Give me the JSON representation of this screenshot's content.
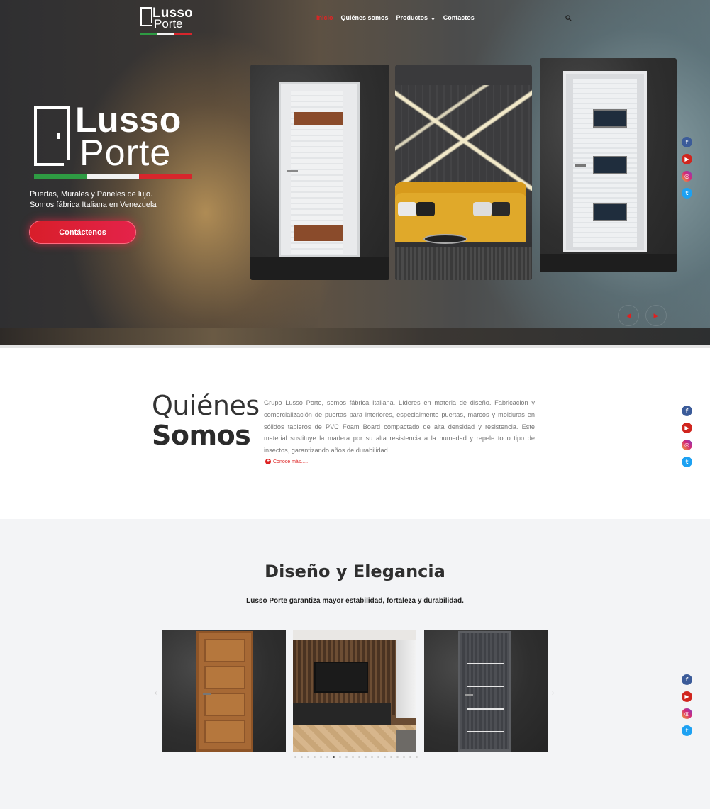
{
  "brand": {
    "name_line1": "Lusso",
    "name_line2": "Porte"
  },
  "nav": {
    "items": [
      {
        "label": "Inicio",
        "active": true
      },
      {
        "label": "Quiénes somos",
        "active": false
      },
      {
        "label": "Productos",
        "active": false,
        "has_dropdown": true
      },
      {
        "label": "Contactos",
        "active": false
      }
    ],
    "search_icon": "search-icon"
  },
  "hero": {
    "logo_line1": "Lusso",
    "logo_line2": "Porte",
    "tagline_line1": "Puertas, Murales y Páneles de lujo.",
    "tagline_line2": "Somos fábrica Italiana en Venezuela",
    "cta_label": "Contáctenos",
    "prev_arrow": "◀",
    "next_arrow": "▶"
  },
  "social": [
    "facebook-icon",
    "youtube-icon",
    "instagram-icon",
    "twitter-icon"
  ],
  "about": {
    "title_light": "Quiénes",
    "title_bold": "Somos",
    "body": "Grupo Lusso Porte, somos fábrica Italiana. Líderes en materia de diseño. Fabricación y comercialización de puertas para interiores, especialmente puertas, marcos y molduras en sólidos tableros de PVC Foam Board compactado de alta densidad y resistencia. Este material sustituye la madera por su alta resistencia a la humedad y repele todo tipo de insectos, garantizando años de durabilidad.",
    "more_label": "Conoce más....."
  },
  "design": {
    "title": "Diseño y Elegancia",
    "subtitle": "Lusso Porte garantiza mayor estabilidad, fortaleza y durabilidad.",
    "carousel_dots": 20,
    "active_dot": 6
  },
  "colors": {
    "accent": "#e22424",
    "flag_green": "#2e9b43",
    "flag_white": "#f1f1f1",
    "flag_red": "#d7262c"
  }
}
